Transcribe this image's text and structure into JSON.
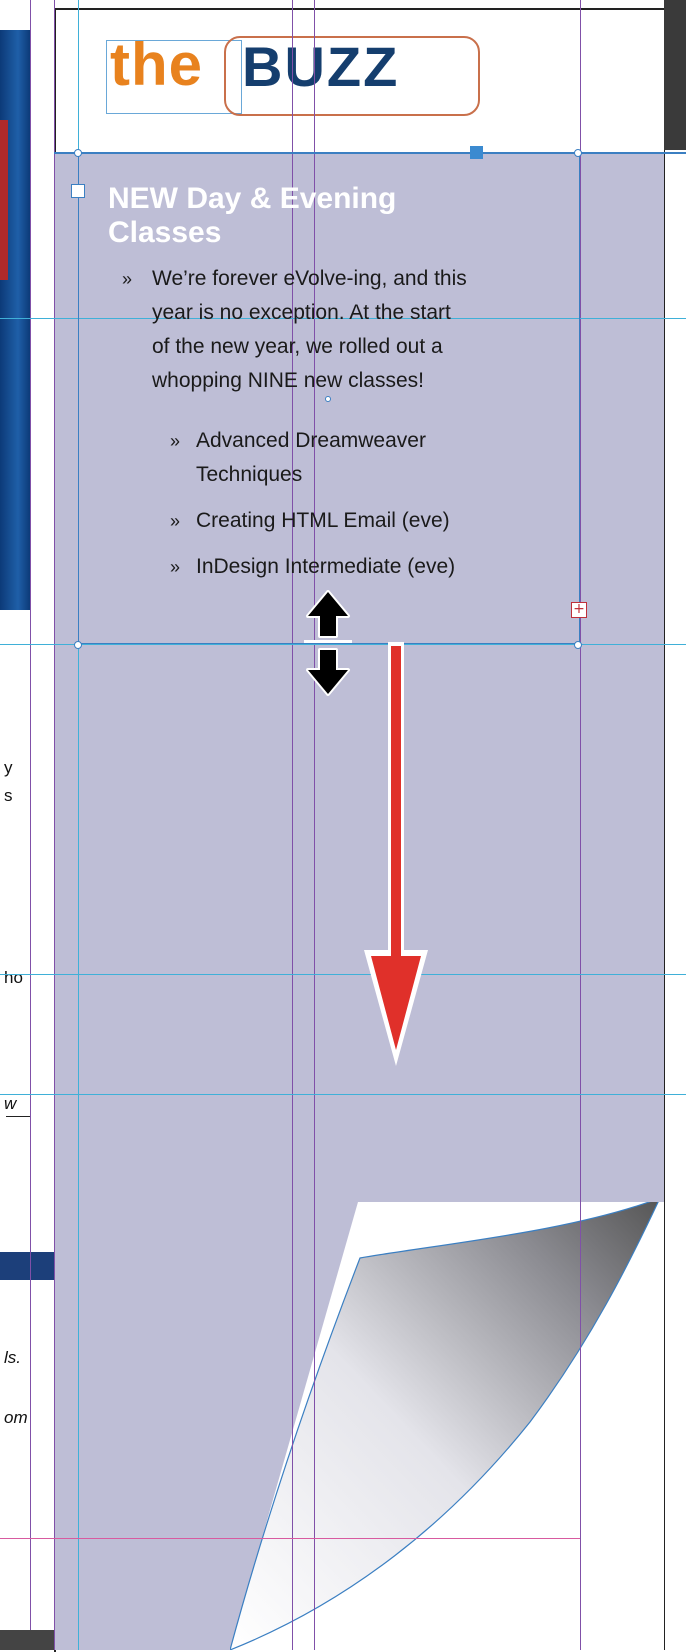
{
  "header": {
    "logo_the": "the",
    "logo_buzz": "BUZZ"
  },
  "article": {
    "heading_line1": "NEW Day & Evening",
    "heading_line2": "Classes",
    "intro_lines": [
      "We’re forever eVolve-ing, and this",
      "year is no exception. At the start",
      "of the new year, we rolled out a",
      "whopping NINE new classes!"
    ],
    "bullet_glyph": "»",
    "sub_items": [
      {
        "line1": "Advanced Dreamweaver",
        "line2": "Techniques"
      },
      {
        "line1": "Creating HTML Email (eve)",
        "line2": ""
      },
      {
        "line1": "InDesign Intermediate (eve)",
        "line2": ""
      }
    ]
  },
  "left_snippets": {
    "s1": "y",
    "s2": "s",
    "s3": "ho",
    "s4": "w",
    "s5": "ls.",
    "s6": "om"
  },
  "overset_symbol": "+",
  "colors": {
    "logo_orange": "#e8821e",
    "logo_navy": "#153e6e",
    "frame_fill": "#bebed6",
    "guide_cyan": "#3fb0d8",
    "guide_purple": "#8050a8",
    "selection_blue": "#3b7fc2",
    "arrow_red": "#e0302a"
  },
  "icons": {
    "resize_cursor": "vertical-resize-cursor-icon",
    "drag_arrow": "down-arrow-icon",
    "overset": "overset-text-icon",
    "page_curl": "page-curl-icon"
  }
}
